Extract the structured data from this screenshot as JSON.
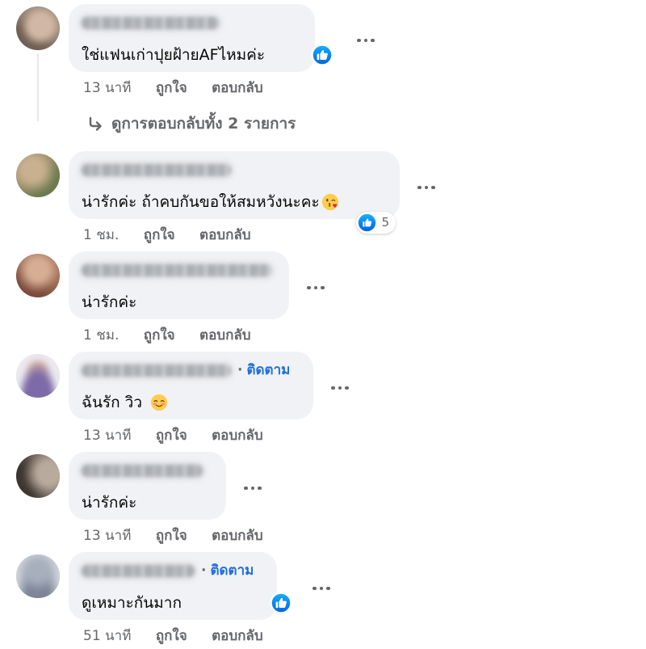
{
  "colors": {
    "bubble_bg": "#f0f2f5",
    "text": "#050505",
    "secondary_text": "#65676b",
    "follow_link": "#216fdb",
    "like_blue": "#1877f2"
  },
  "ui": {
    "separator": "·",
    "like_label": "ถูกใจ",
    "reply_label": "ตอบกลับ",
    "more_icon": "more-options-icon",
    "like_icon": "like-icon"
  },
  "comments": [
    {
      "text": "ใช่แฟนเก่าปุยฝ้ายAFไหมค่ะ",
      "time": "13 นาที",
      "reaction": {
        "icon": "like-icon"
      },
      "replies_link": {
        "icon": "reply-arrow-icon",
        "label": "ดูการตอบกลับทั้ง 2 รายการ"
      }
    },
    {
      "text": "น่ารักค่ะ ถ้าคบกันขอให้สมหวังนะคะ",
      "emoji_icon": "face-blowing-kiss-icon",
      "time": "1 ชม.",
      "reaction": {
        "icon": "like-icon",
        "count": 5
      }
    },
    {
      "text": "น่ารักค่ะ",
      "time": "1 ชม."
    },
    {
      "text": "ฉันรัก วิว",
      "emoji_icon": "smiling-face-icon",
      "follow": "ติดตาม",
      "time": "13 นาที"
    },
    {
      "text": "น่ารักค่ะ",
      "time": "13 นาที"
    },
    {
      "text": "ดูเหมาะกันมาก",
      "follow": "ติดตาม",
      "time": "51 นาที",
      "reaction": {
        "icon": "like-icon"
      }
    }
  ]
}
